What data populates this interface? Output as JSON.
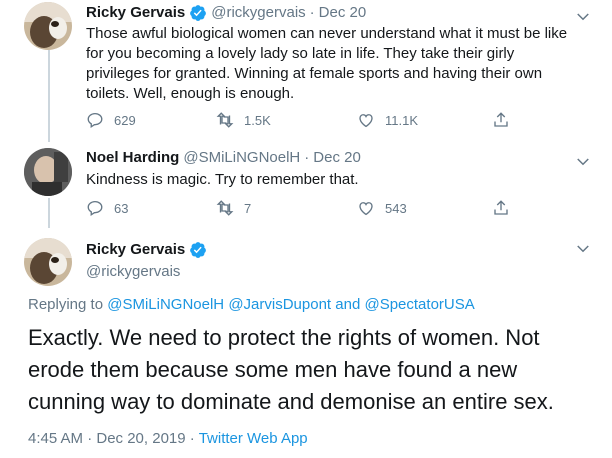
{
  "tweet1": {
    "name": "Ricky Gervais",
    "handle": "@rickygervais",
    "time": "Dec 20",
    "lines": [
      "Those awful biological women can never understand what it must be like",
      "for you becoming a lovely lady so late in life. They take their girly",
      "privileges for granted. Winning at female sports and having their own",
      "toilets. Well, enough is enough."
    ],
    "replies": "629",
    "retweets": "1.5K",
    "likes": "11.1K"
  },
  "tweet2": {
    "name": "Noel Harding",
    "handle": "@SMiLiNGNoelH",
    "time": "Dec 20",
    "text": "Kindness is magic. Try to remember that.",
    "replies": "63",
    "retweets": "7",
    "likes": "543"
  },
  "main_tweet": {
    "name": "Ricky Gervais",
    "handle": "@rickygervais",
    "replying_prefix": "Replying to",
    "replying_to": [
      "@SMiLiNGNoelH",
      "@JarvisDupont",
      "@SpectatorUSA"
    ],
    "and_word": "and",
    "lines": [
      "Exactly. We need to protect the rights of women. Not",
      "erode them because some men have found a new",
      "cunning way to dominate and demonise an entire sex."
    ],
    "timestamp": "4:45 AM · Dec 20, 2019",
    "source": "Twitter Web App"
  },
  "separator": "·",
  "colors": {
    "blue": "#1b95e0",
    "grey": "#657786",
    "text": "#14171a",
    "verified": "#1da1f2"
  },
  "icons": [
    "verified-icon",
    "chevron-down-icon",
    "reply-icon",
    "retweet-icon",
    "like-icon",
    "share-icon"
  ]
}
